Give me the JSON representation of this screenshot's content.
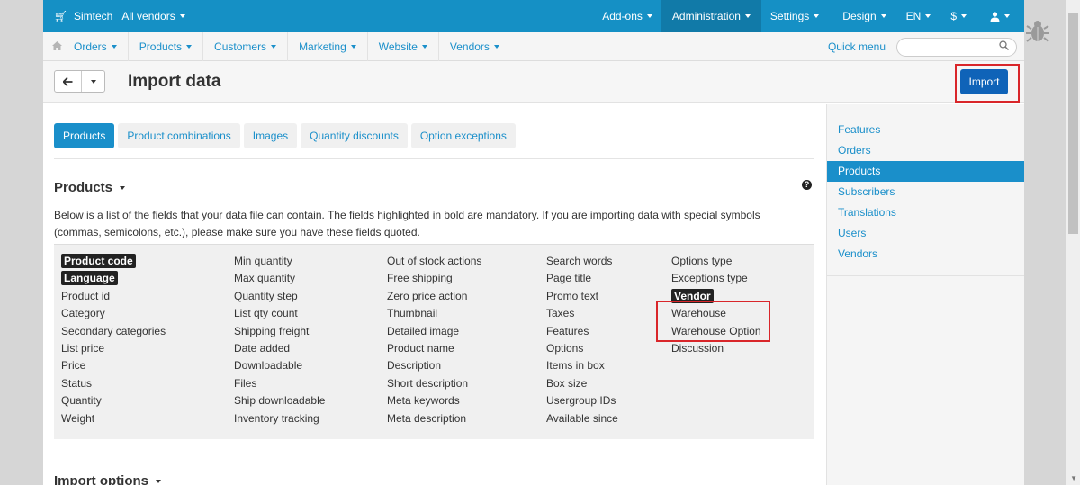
{
  "topbar": {
    "brand": "Simtech",
    "vendor_select": "All vendors",
    "right_items": [
      "Add-ons",
      "Administration",
      "Settings",
      "Design",
      "EN",
      "$",
      ""
    ]
  },
  "subnav": {
    "items": [
      "Orders",
      "Products",
      "Customers",
      "Marketing",
      "Website",
      "Vendors"
    ],
    "quick_menu": "Quick menu",
    "search_placeholder": ""
  },
  "titlebar": {
    "title": "Import data",
    "import_label": "Import"
  },
  "tabs": [
    "Products",
    "Product combinations",
    "Images",
    "Quantity discounts",
    "Option exceptions"
  ],
  "section": {
    "title": "Products",
    "help": "?",
    "description": "Below is a list of the fields that your data file can contain. The fields highlighted in bold are mandatory. If you are importing data with special symbols (commas, semicolons, etc.), please make sure you have these fields quoted."
  },
  "fields": {
    "col1": [
      {
        "label": "Product code",
        "required": true
      },
      {
        "label": "Language",
        "required": true
      },
      {
        "label": "Product id",
        "required": false
      },
      {
        "label": "Category",
        "required": false
      },
      {
        "label": "Secondary categories",
        "required": false
      },
      {
        "label": "List price",
        "required": false
      },
      {
        "label": "Price",
        "required": false
      },
      {
        "label": "Status",
        "required": false
      },
      {
        "label": "Quantity",
        "required": false
      },
      {
        "label": "Weight",
        "required": false
      }
    ],
    "col2": [
      {
        "label": "Min quantity",
        "required": false
      },
      {
        "label": "Max quantity",
        "required": false
      },
      {
        "label": "Quantity step",
        "required": false
      },
      {
        "label": "List qty count",
        "required": false
      },
      {
        "label": "Shipping freight",
        "required": false
      },
      {
        "label": "Date added",
        "required": false
      },
      {
        "label": "Downloadable",
        "required": false
      },
      {
        "label": "Files",
        "required": false
      },
      {
        "label": "Ship downloadable",
        "required": false
      },
      {
        "label": "Inventory tracking",
        "required": false
      }
    ],
    "col3": [
      {
        "label": "Out of stock actions",
        "required": false
      },
      {
        "label": "Free shipping",
        "required": false
      },
      {
        "label": "Zero price action",
        "required": false
      },
      {
        "label": "Thumbnail",
        "required": false
      },
      {
        "label": "Detailed image",
        "required": false
      },
      {
        "label": "Product name",
        "required": false
      },
      {
        "label": "Description",
        "required": false
      },
      {
        "label": "Short description",
        "required": false
      },
      {
        "label": "Meta keywords",
        "required": false
      },
      {
        "label": "Meta description",
        "required": false
      }
    ],
    "col4": [
      {
        "label": "Search words",
        "required": false
      },
      {
        "label": "Page title",
        "required": false
      },
      {
        "label": "Promo text",
        "required": false
      },
      {
        "label": "Taxes",
        "required": false
      },
      {
        "label": "Features",
        "required": false
      },
      {
        "label": "Options",
        "required": false
      },
      {
        "label": "Items in box",
        "required": false
      },
      {
        "label": "Box size",
        "required": false
      },
      {
        "label": "Usergroup IDs",
        "required": false
      },
      {
        "label": "Available since",
        "required": false
      }
    ],
    "col5": [
      {
        "label": "Options type",
        "required": false
      },
      {
        "label": "Exceptions type",
        "required": false
      },
      {
        "label": "Vendor",
        "required": true
      },
      {
        "label": "Warehouse",
        "required": false
      },
      {
        "label": "Warehouse Option",
        "required": false
      },
      {
        "label": "Discussion",
        "required": false
      }
    ]
  },
  "next_section": "Import options",
  "sidebar": {
    "items": [
      "Features",
      "Orders",
      "Products",
      "Subscribers",
      "Translations",
      "Users",
      "Vendors"
    ],
    "active": "Products"
  },
  "colors": {
    "topbar": "#1590c5",
    "accent": "#1a8fca",
    "import_button": "#0f63b8",
    "highlight_box": "#d9262a"
  }
}
